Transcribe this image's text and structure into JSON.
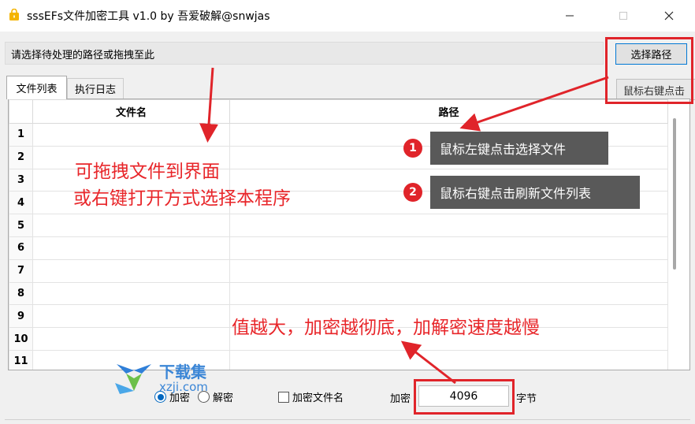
{
  "window": {
    "title": "sssEFs文件加密工具 v1.0 by 吾爱破解@snwjas",
    "icon": "lock-icon"
  },
  "toolbar": {
    "path_prompt": "请选择待处理的路径或拖拽至此",
    "select_path_button": "选择路径",
    "refresh_hint_button": "鼠标右键点击"
  },
  "tabs": [
    {
      "label": "文件列表",
      "active": true
    },
    {
      "label": "执行日志",
      "active": false
    }
  ],
  "grid": {
    "columns": [
      "文件名",
      "路径"
    ],
    "row_numbers": [
      "1",
      "2",
      "3",
      "4",
      "5",
      "6",
      "7",
      "8",
      "9",
      "10",
      "11"
    ]
  },
  "options": {
    "mode_encrypt": "加密",
    "mode_decrypt": "解密",
    "mode_selected": "加密",
    "encrypt_filename_label": "加密文件名",
    "encrypt_filename_checked": false,
    "encrypt_size_label": "加密",
    "encrypt_size_value": "4096",
    "encrypt_size_unit": "字节"
  },
  "annotations": {
    "drag_hint_line1": "可拖拽文件到界面",
    "drag_hint_line2": "或右键打开方式选择本程序",
    "callout_1_number": "1",
    "callout_1_text": "鼠标左键点击选择文件",
    "callout_2_number": "2",
    "callout_2_text": "鼠标右键点击刷新文件列表",
    "size_hint": "值越大，加密越彻底，加解密速度越慢",
    "color": "#e0242a"
  },
  "watermark": {
    "title": "下载集",
    "site": "xzji.com"
  }
}
